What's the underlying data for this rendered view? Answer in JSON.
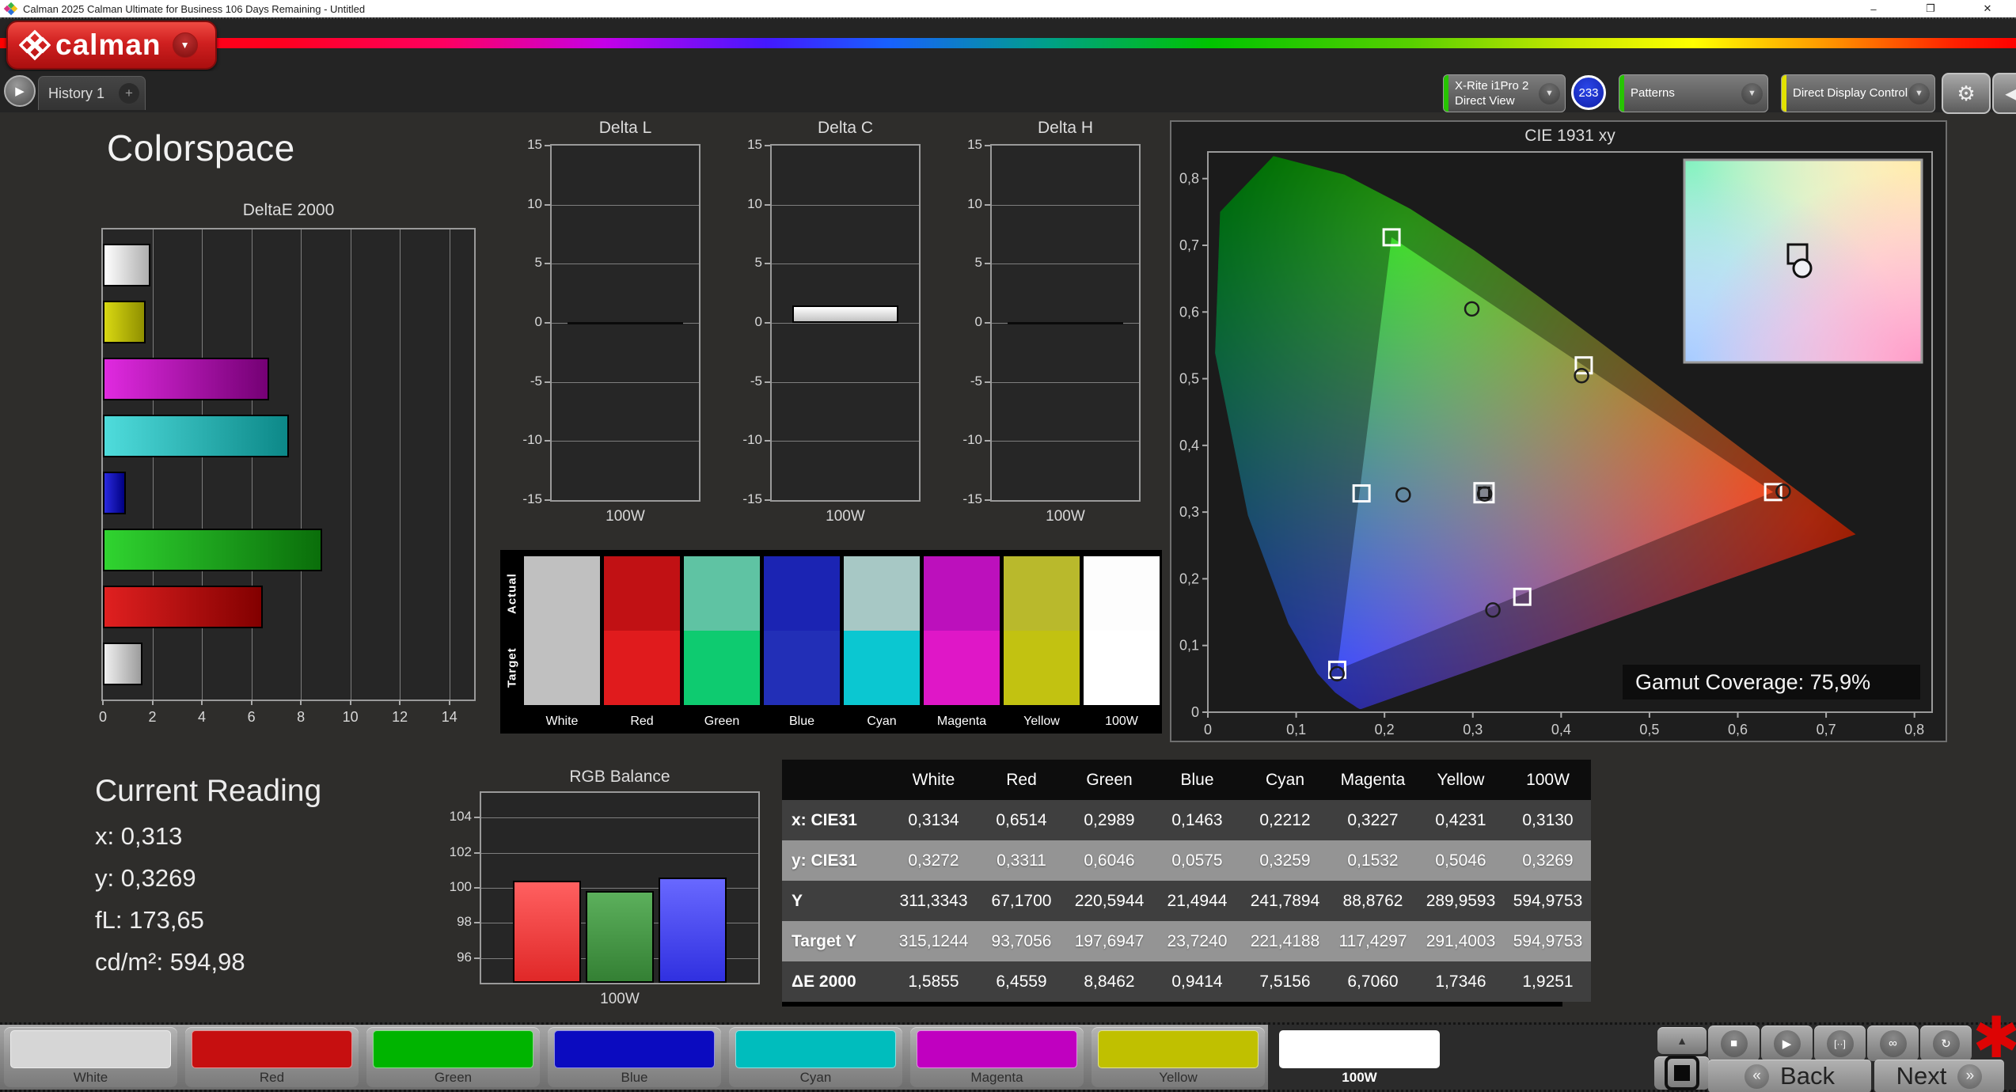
{
  "window": {
    "title": "Calman 2025 Calman Ultimate for Business 106 Days Remaining  - Untitled",
    "controls": {
      "minimize": "–",
      "restore": "❐",
      "close": "✕"
    }
  },
  "brand": {
    "logo_text": "calman",
    "caret": "▼"
  },
  "toolbar": {
    "scroll_icon": "▶",
    "history_tab": "History 1",
    "add_tab": "+",
    "meter": {
      "line1": "X-Rite i1Pro 2",
      "line2": "Direct View",
      "badge": "233",
      "accent": "#27c400"
    },
    "patterns": {
      "label": "Patterns",
      "accent": "#27c400"
    },
    "display_control": {
      "label": "Direct Display Control",
      "accent": "#e2e200"
    },
    "gear_icon": "⚙",
    "collapse_icon": "◀",
    "caret": "▼"
  },
  "page_title": "Colorspace",
  "current_reading": {
    "heading": "Current Reading",
    "lines": [
      {
        "label": "x:",
        "value": "0,313"
      },
      {
        "label": "y:",
        "value": "0,3269"
      },
      {
        "label": "fL:",
        "value": "173,65"
      },
      {
        "label": "cd/m²:",
        "value": "594,98"
      }
    ]
  },
  "swatch_panel": {
    "row_labels": [
      "Actual",
      "Target"
    ],
    "columns": [
      {
        "label": "White",
        "actual": "#c0c0c0",
        "target": "#c0c0c0"
      },
      {
        "label": "Red",
        "actual": "#c11114",
        "target": "#e01b1d"
      },
      {
        "label": "Green",
        "actual": "#5fc3a3",
        "target": "#0ecb70"
      },
      {
        "label": "Blue",
        "actual": "#1b24b3",
        "target": "#222fb7"
      },
      {
        "label": "Cyan",
        "actual": "#a7c8c5",
        "target": "#0bc7d1"
      },
      {
        "label": "Magenta",
        "actual": "#bc10bc",
        "target": "#df17c7"
      },
      {
        "label": "Yellow",
        "actual": "#b9b92c",
        "target": "#c2c211"
      },
      {
        "label": "100W",
        "actual": "#fdfdfd",
        "target": "#ffffff"
      }
    ]
  },
  "chart_data": [
    {
      "id": "deltae2000",
      "type": "bar",
      "orientation": "horizontal",
      "title": "DeltaE 2000",
      "categories": [
        "100W",
        "Yellow",
        "Magenta",
        "Cyan",
        "Blue",
        "Green",
        "Red",
        "White"
      ],
      "values": [
        1.9251,
        1.7346,
        6.706,
        7.5156,
        0.9414,
        8.8462,
        6.4559,
        1.5855
      ],
      "xlim": [
        0,
        15
      ],
      "xticks": [
        0,
        2,
        4,
        6,
        8,
        10,
        12,
        14
      ],
      "bar_colors": [
        [
          "#ffffff",
          "#aeaeae"
        ],
        [
          "#d9d912",
          "#8f8f00"
        ],
        [
          "#e02ae0",
          "#740074"
        ],
        [
          "#4fdcdc",
          "#0c8888"
        ],
        [
          "#2a2ae0",
          "#000082"
        ],
        [
          "#30d430",
          "#0a6e0a"
        ],
        [
          "#e02020",
          "#820000"
        ],
        [
          "#f0f0f0",
          "#9c9c9c"
        ]
      ]
    },
    {
      "id": "delta_l",
      "type": "bar",
      "title": "Delta L",
      "categories": [
        "100W"
      ],
      "values": [
        0.0
      ],
      "xlabel": "100W",
      "ylim": [
        -15,
        15
      ],
      "yticks": [
        15,
        10,
        5,
        0,
        -5,
        -10,
        -15
      ]
    },
    {
      "id": "delta_c",
      "type": "bar",
      "title": "Delta C",
      "categories": [
        "100W"
      ],
      "values": [
        1.5
      ],
      "xlabel": "100W",
      "ylim": [
        -15,
        15
      ],
      "yticks": [
        15,
        10,
        5,
        0,
        -5,
        -10,
        -15
      ],
      "bar_colors": [
        [
          "#ffffff",
          "#c2c2c2"
        ]
      ]
    },
    {
      "id": "delta_h",
      "type": "bar",
      "title": "Delta H",
      "categories": [
        "100W"
      ],
      "values": [
        0.0
      ],
      "xlabel": "100W",
      "ylim": [
        -15,
        15
      ],
      "yticks": [
        15,
        10,
        5,
        0,
        -5,
        -10,
        -15
      ]
    },
    {
      "id": "cie1931",
      "type": "scatter",
      "title": "CIE 1931 xy",
      "xlim": [
        0,
        0.82
      ],
      "ylim": [
        0,
        0.84
      ],
      "xticks": [
        0,
        0.1,
        0.2,
        0.3,
        0.4,
        0.5,
        0.6,
        0.7,
        0.8
      ],
      "yticks": [
        0,
        0.1,
        0.2,
        0.3,
        0.4,
        0.5,
        0.6,
        0.7,
        0.8
      ],
      "gamut_triangle": [
        [
          0.64,
          0.33
        ],
        [
          0.208,
          0.712
        ],
        [
          0.1465,
          0.0636
        ]
      ],
      "targets": [
        {
          "name": "red",
          "x": 0.64,
          "y": 0.33
        },
        {
          "name": "green",
          "x": 0.208,
          "y": 0.712
        },
        {
          "name": "blue",
          "x": 0.1465,
          "y": 0.0636
        },
        {
          "name": "cyan",
          "x": 0.174,
          "y": 0.328
        },
        {
          "name": "magenta",
          "x": 0.356,
          "y": 0.173
        },
        {
          "name": "yellow",
          "x": 0.4256,
          "y": 0.52
        },
        {
          "name": "white",
          "x": 0.3127,
          "y": 0.329
        }
      ],
      "measured": [
        {
          "name": "red",
          "x": 0.6514,
          "y": 0.3311
        },
        {
          "name": "green",
          "x": 0.2989,
          "y": 0.6046
        },
        {
          "name": "blue",
          "x": 0.1463,
          "y": 0.0575
        },
        {
          "name": "cyan",
          "x": 0.2212,
          "y": 0.3259
        },
        {
          "name": "magenta",
          "x": 0.3227,
          "y": 0.1532
        },
        {
          "name": "yellow",
          "x": 0.4231,
          "y": 0.5046
        },
        {
          "name": "white",
          "x": 0.3134,
          "y": 0.3272
        }
      ],
      "coverage_label": "Gamut Coverage:",
      "coverage_value": "75,9%"
    },
    {
      "id": "rgb_balance",
      "type": "bar",
      "title": "RGB Balance",
      "categories": [
        "Red",
        "Green",
        "Blue"
      ],
      "values": [
        100.4,
        99.8,
        100.6
      ],
      "xlabel": "100W",
      "ylim": [
        94.6,
        105.4
      ],
      "yticks": [
        104,
        102,
        100,
        98,
        96
      ],
      "bar_colors": [
        [
          "#ff6060",
          "#e02828"
        ],
        [
          "#5cb05c",
          "#348034"
        ],
        [
          "#6868ff",
          "#3030e0"
        ]
      ]
    },
    {
      "id": "measurement_table",
      "type": "table",
      "columns": [
        "",
        "White",
        "Red",
        "Green",
        "Blue",
        "Cyan",
        "Magenta",
        "Yellow",
        "100W"
      ],
      "rows": [
        [
          "x: CIE31",
          "0,3134",
          "0,6514",
          "0,2989",
          "0,1463",
          "0,2212",
          "0,3227",
          "0,4231",
          "0,3130"
        ],
        [
          "y: CIE31",
          "0,3272",
          "0,3311",
          "0,6046",
          "0,0575",
          "0,3259",
          "0,1532",
          "0,5046",
          "0,3269"
        ],
        [
          "Y",
          "311,3343",
          "67,1700",
          "220,5944",
          "21,4944",
          "241,7894",
          "88,8762",
          "289,9593",
          "594,9753"
        ],
        [
          "Target Y",
          "315,1244",
          "93,7056",
          "197,6947",
          "23,7240",
          "221,4188",
          "117,4297",
          "291,4003",
          "594,9753"
        ],
        [
          "ΔE 2000",
          "1,5855",
          "6,4559",
          "8,8462",
          "0,9414",
          "7,5156",
          "6,7060",
          "1,7346",
          "1,9251"
        ]
      ]
    }
  ],
  "pattern_bar": {
    "buttons": [
      {
        "label": "White",
        "color": "#d6d6d6",
        "selected": false
      },
      {
        "label": "Red",
        "color": "#c60f10",
        "selected": false
      },
      {
        "label": "Green",
        "color": "#00b400",
        "selected": false
      },
      {
        "label": "Blue",
        "color": "#0b0bc0",
        "selected": false
      },
      {
        "label": "Cyan",
        "color": "#00bdbd",
        "selected": false
      },
      {
        "label": "Magenta",
        "color": "#c000c0",
        "selected": false
      },
      {
        "label": "Yellow",
        "color": "#c0c000",
        "selected": false
      },
      {
        "label": "100W",
        "color": "#ffffff",
        "selected": true
      }
    ],
    "controls": {
      "up": "▲",
      "stop": "■",
      "play": "▶",
      "range": "[··]",
      "loop": "∞",
      "refresh": "↻",
      "asterisk": "✱"
    },
    "nav": {
      "back": "Back",
      "back_icon": "«",
      "next": "Next",
      "next_icon": "»"
    }
  }
}
